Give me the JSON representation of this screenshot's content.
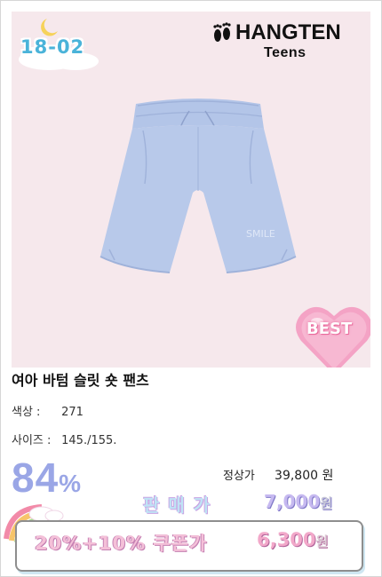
{
  "product": {
    "code": "18-02",
    "brand_main": "HANGTEN",
    "brand_sub": "Teens",
    "badge": "BEST",
    "title": "여아 바텀 슬릿 숏 팬츠",
    "color_label": "색상 :",
    "color_value": "271",
    "size_label": "사이즈 :",
    "size_value": "145./155.",
    "embroidery": "SMILE"
  },
  "pricing": {
    "discount_number": "84",
    "discount_symbol": "%",
    "regular_label": "정상가",
    "regular_price": "39,800 원",
    "sale_label": "판매가",
    "sale_price": "7,000",
    "sale_unit": "원",
    "coupon_label": "20%+10% 쿠폰가",
    "coupon_price": "6,300",
    "coupon_unit": "원"
  },
  "colors": {
    "image_bg": "#f6e8ec",
    "shorts": "#b8c9ea",
    "code_text": "#4ab3d9",
    "discount": "#9aa6e6",
    "best_heart": "#f4a3c5"
  }
}
